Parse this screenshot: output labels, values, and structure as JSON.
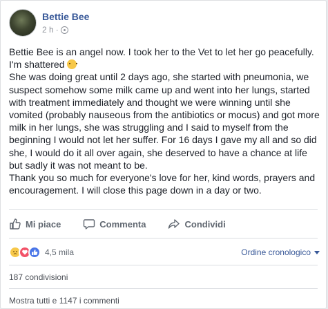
{
  "post": {
    "author": "Bettie Bee",
    "time": "2 h",
    "time_separator": "·",
    "privacy_icon": "globe-icon",
    "paragraph_1": "Bettie Bee is an angel now. I took her to the Vet to let her go peacefully. I'm shattered",
    "paragraph_2": "She was doing great until 2 days ago, she started with pneumonia, we suspect somehow some milk came up and went into her lungs, started with treatment immediately and thought we were winning until she vomited (probably nauseous from the antibiotics or mocus) and got more milk in her lungs, she was struggling and I said to myself from the beginning I would not let her suffer. For 16 days I gave my all and so did she, I would do it all over again, she deserved to have a chance at life but sadly it was not meant to be.",
    "paragraph_3": "Thank you so much for everyone's love for her, kind words, prayers and encouragement. I will close this page down in a day or two."
  },
  "actions": {
    "like": "Mi piace",
    "comment": "Commenta",
    "share": "Condividi"
  },
  "reactions": {
    "icons": [
      "sad-reaction-icon",
      "love-reaction-icon",
      "like-reaction-icon"
    ],
    "count": "4,5 mila"
  },
  "order": {
    "label": "Ordine cronologico"
  },
  "shares": "187 condivisioni",
  "comments": "Mostra tutti e 1147 i commenti",
  "colors": {
    "link": "#385898",
    "muted": "#606770",
    "like_blue": "#4a76e8",
    "love_red": "#f25268",
    "sad_yellow": "#f7c84a"
  }
}
